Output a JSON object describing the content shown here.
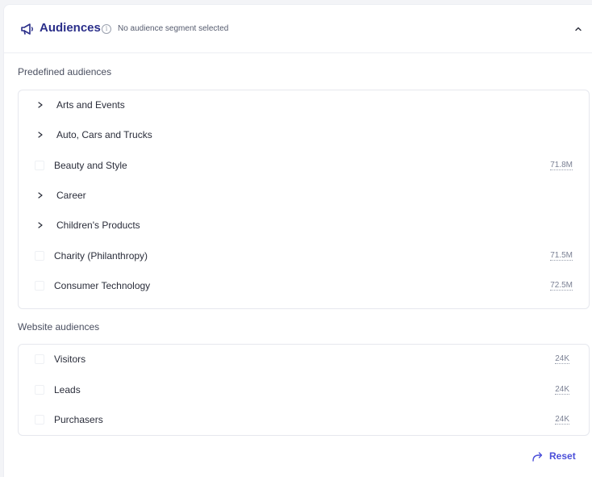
{
  "header": {
    "title": "Audiences",
    "subtitle": "No audience segment selected",
    "icon": "megaphone-icon",
    "collapse_icon": "chevron-up-icon"
  },
  "predefined": {
    "label": "Predefined audiences",
    "items": [
      {
        "label": "Arts and Events",
        "type": "expandable",
        "size": ""
      },
      {
        "label": "Auto, Cars and Trucks",
        "type": "expandable",
        "size": ""
      },
      {
        "label": "Beauty and Style",
        "type": "checkbox",
        "size": "71.8M"
      },
      {
        "label": "Career",
        "type": "expandable",
        "size": ""
      },
      {
        "label": "Children's Products",
        "type": "expandable",
        "size": ""
      },
      {
        "label": "Charity (Philanthropy)",
        "type": "checkbox",
        "size": "71.5M"
      },
      {
        "label": "Consumer Technology",
        "type": "checkbox",
        "size": "72.5M"
      }
    ]
  },
  "website": {
    "label": "Website audiences",
    "items": [
      {
        "label": "Visitors",
        "type": "checkbox",
        "size": "24K"
      },
      {
        "label": "Leads",
        "type": "checkbox",
        "size": "24K"
      },
      {
        "label": "Purchasers",
        "type": "checkbox",
        "size": "24K"
      }
    ]
  },
  "footer": {
    "reset_label": "Reset"
  },
  "colors": {
    "accent": "#4b4fd9",
    "title": "#2b2f8a"
  }
}
